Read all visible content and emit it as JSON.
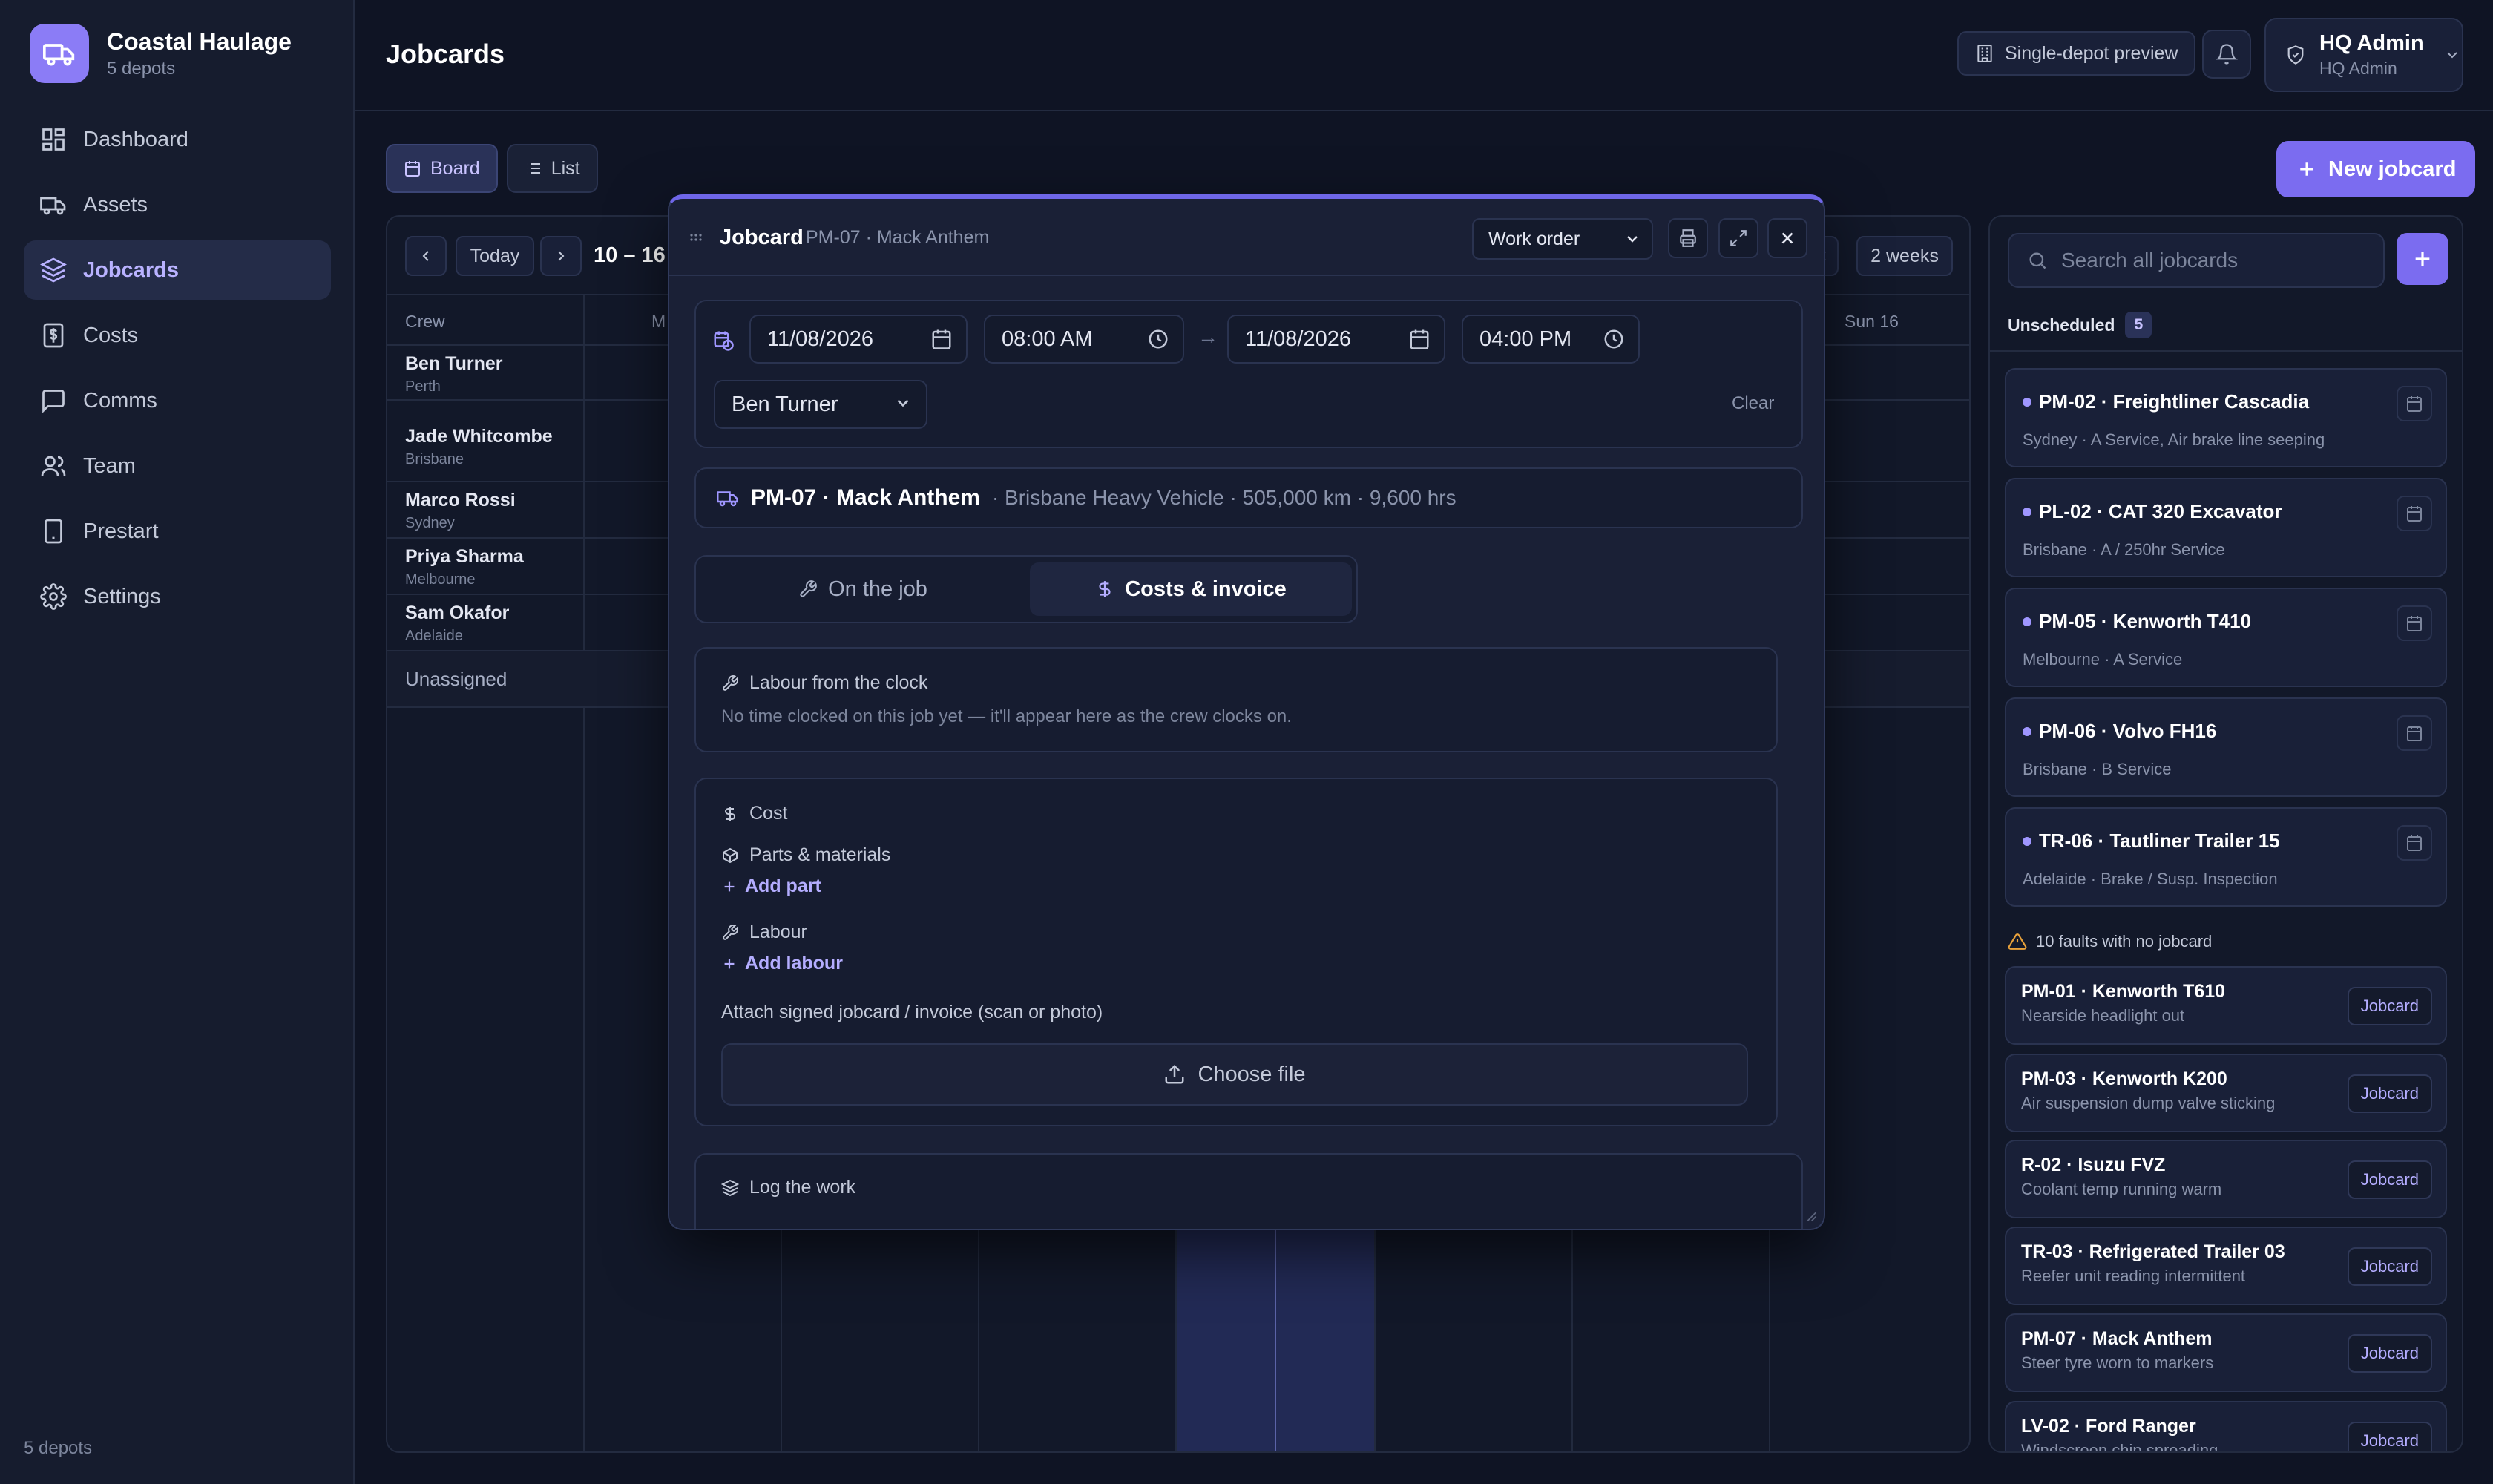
{
  "app": {
    "name": "Coastal Haulage",
    "subtitle": "5 depots",
    "footer": "5 depots"
  },
  "nav": [
    {
      "label": "Dashboard",
      "icon": "dashboard-icon"
    },
    {
      "label": "Assets",
      "icon": "truck-icon"
    },
    {
      "label": "Jobcards",
      "icon": "layers-icon",
      "active": true
    },
    {
      "label": "Costs",
      "icon": "dollar-icon"
    },
    {
      "label": "Comms",
      "icon": "message-icon"
    },
    {
      "label": "Team",
      "icon": "team-icon"
    },
    {
      "label": "Prestart",
      "icon": "tablet-icon"
    },
    {
      "label": "Settings",
      "icon": "gear-icon"
    }
  ],
  "header": {
    "title": "Jobcards",
    "preview_label": "Single-depot preview",
    "user_name": "HQ Admin",
    "user_role": "HQ Admin"
  },
  "views": {
    "board": "Board",
    "list": "List"
  },
  "new_jobcard": "New jobcard",
  "board": {
    "today": "Today",
    "week": "10 – 16",
    "range": "2 weeks",
    "crew_header": "Crew",
    "mon_header": "M",
    "sun_header": "Sun 16",
    "crew": [
      {
        "name": "Ben Turner",
        "city": "Perth"
      },
      {
        "name": "Jade Whitcombe",
        "city": "Brisbane"
      },
      {
        "name": "Marco Rossi",
        "city": "Sydney"
      },
      {
        "name": "Priya Sharma",
        "city": "Melbourne"
      },
      {
        "name": "Sam Okafor",
        "city": "Adelaide"
      }
    ],
    "unassigned": "Unassigned"
  },
  "sidepanel": {
    "search_placeholder": "Search all jobcards",
    "unscheduled_label": "Unscheduled",
    "unscheduled_count": "5",
    "unscheduled": [
      {
        "title": "PM-02 · Freightliner Cascadia",
        "sub": "Sydney · A Service, Air brake line seeping"
      },
      {
        "title": "PL-02 · CAT 320 Excavator",
        "sub": "Brisbane · A / 250hr Service"
      },
      {
        "title": "PM-05 · Kenworth T410",
        "sub": "Melbourne · A Service"
      },
      {
        "title": "PM-06 · Volvo FH16",
        "sub": "Brisbane · B Service"
      },
      {
        "title": "TR-06 · Tautliner Trailer 15",
        "sub": "Adelaide · Brake / Susp. Inspection"
      }
    ],
    "faults_label": "10 faults with no jobcard",
    "fault_button": "Jobcard",
    "faults": [
      {
        "title": "PM-01 · Kenworth T610",
        "sub": "Nearside headlight out"
      },
      {
        "title": "PM-03 · Kenworth K200",
        "sub": "Air suspension dump valve sticking"
      },
      {
        "title": "R-02 · Isuzu FVZ",
        "sub": "Coolant temp running warm"
      },
      {
        "title": "TR-03 · Refrigerated Trailer 03",
        "sub": "Reefer unit reading intermittent"
      },
      {
        "title": "PM-07 · Mack Anthem",
        "sub": "Steer tyre worn to markers"
      },
      {
        "title": "LV-02 · Ford Ranger",
        "sub": "Windscreen chip spreading"
      }
    ]
  },
  "modal": {
    "title": "Jobcard",
    "subtitle": "PM-07 · Mack Anthem",
    "type_select": "Work order",
    "start_date": "11/08/2026",
    "start_time": "08:00 AM",
    "end_date": "11/08/2026",
    "end_time": "04:00 PM",
    "arrow": "→",
    "assignee": "Ben Turner",
    "clear": "Clear",
    "asset_title": "PM-07 · Mack Anthem",
    "asset_meta": "· Brisbane Heavy Vehicle · 505,000 km · 9,600 hrs",
    "tab_job": "On the job",
    "tab_costs": "Costs & invoice",
    "labour_clock_title": "Labour from the clock",
    "labour_clock_hint": "No time clocked on this job yet — it'll appear here as the crew clocks on.",
    "cost_title": "Cost",
    "parts_label": "Parts & materials",
    "add_part": "Add part",
    "labour_label": "Labour",
    "add_labour": "Add labour",
    "attach_label": "Attach signed jobcard / invoice (scan or photo)",
    "choose_file": "Choose file",
    "log_work": "Log the work"
  },
  "colors": {
    "accent": "#7b6cf0",
    "background": "#0f1424",
    "panel": "#161c2e"
  }
}
